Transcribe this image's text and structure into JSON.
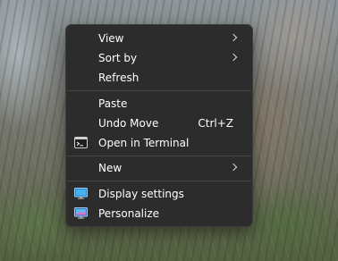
{
  "context_menu": {
    "view": "View",
    "sort_by": "Sort by",
    "refresh": "Refresh",
    "paste": "Paste",
    "undo_move": "Undo Move",
    "undo_move_shortcut": "Ctrl+Z",
    "open_in_terminal": "Open in Terminal",
    "new": "New",
    "display_settings": "Display settings",
    "personalize": "Personalize"
  },
  "icons": {
    "terminal": "terminal-icon",
    "display": "display-settings-icon",
    "personalize": "personalize-icon"
  },
  "colors": {
    "menu_background": "#2c2c2c",
    "text": "#ffffff",
    "separator": "#454545",
    "icon_blue": "#3aa0e6"
  }
}
